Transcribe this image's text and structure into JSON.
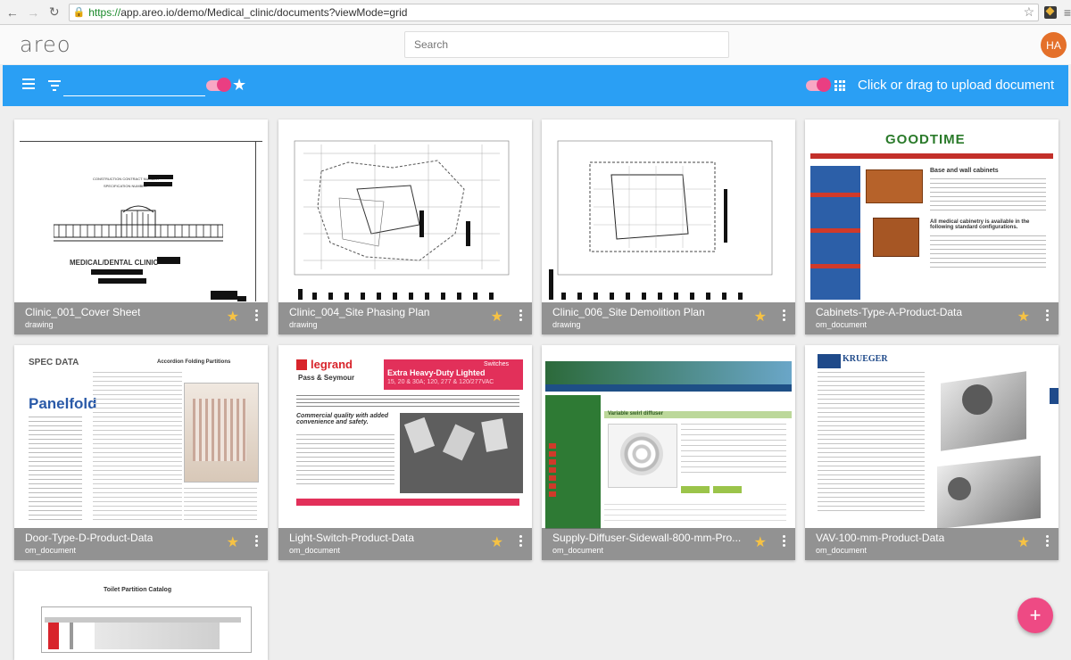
{
  "browser": {
    "url_scheme": "https://",
    "url_rest": "app.areo.io/demo/Medical_clinic/documents?viewMode=grid"
  },
  "app": {
    "logo": "areo",
    "search_placeholder": "Search",
    "avatar_initials": "HA",
    "avatar_color": "#e4702a"
  },
  "toolbar": {
    "color": "#2a9ff4",
    "upload_label": "Click or drag to upload document"
  },
  "documents": [
    {
      "title": "Clinic_001_Cover Sheet",
      "type": "drawing",
      "starred": true
    },
    {
      "title": "Clinic_004_Site Phasing Plan",
      "type": "drawing",
      "starred": true
    },
    {
      "title": "Clinic_006_Site Demolition Plan",
      "type": "drawing",
      "starred": true
    },
    {
      "title": "Cabinets-Type-A-Product-Data",
      "type": "om_document",
      "starred": true
    },
    {
      "title": "Door-Type-D-Product-Data",
      "type": "om_document",
      "starred": true
    },
    {
      "title": "Light-Switch-Product-Data",
      "type": "om_document",
      "starred": true
    },
    {
      "title": "Supply-Diffuser-Sidewall-800-mm-Pro...",
      "type": "om_document",
      "starred": true
    },
    {
      "title": "VAV-100-mm-Product-Data",
      "type": "om_document",
      "starred": true
    }
  ],
  "thumb_text": {
    "cover_label": "MEDICAL/DENTAL CLINIC",
    "cover_line1": "CONSTRUCTION CONTRACT NUMBER",
    "cover_line2": "SPECIFICATION NUMBER",
    "cabinet_brand": "GOODTIME",
    "cabinet_heading": "Base and wall cabinets",
    "cabinet_sub": "All medical cabinetry is available in the following standard configurations.",
    "door_brand": "Panelfold",
    "door_heading": "Accordion Folding Partitions",
    "door_spec": "SPEC DATA",
    "light_brand": "legrand",
    "light_sub": "Pass & Seymour",
    "light_banner": "Extra Heavy-Duty Lighted",
    "light_banner2": "15, 20 & 30A; 120, 277 & 120/277VAC",
    "light_tag": "Switches",
    "light_tagline": "Commercial quality with added convenience and safety.",
    "diffuser_header": "Variable swirl diffuser",
    "vav_brand": "KRUEGER",
    "toilet_title": "Toilet Partition Catalog"
  },
  "fab": {
    "label": "+",
    "color": "#ee4a84"
  }
}
